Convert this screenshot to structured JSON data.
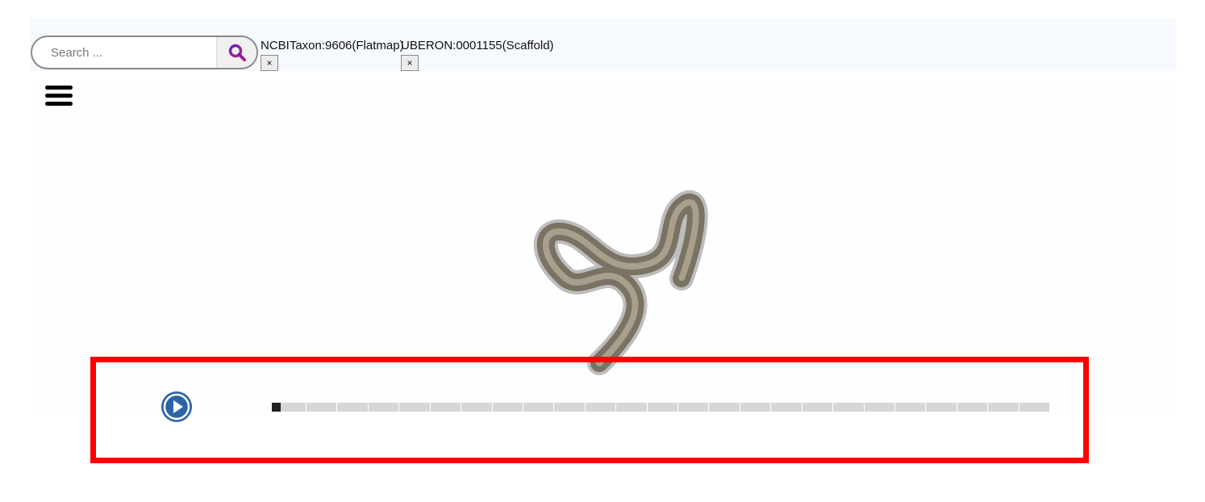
{
  "search": {
    "placeholder": "Search ..."
  },
  "tags": [
    {
      "label": "NCBITaxon:9606(Flatmap)",
      "close": "×"
    },
    {
      "label": "UBERON:0001155(Scaffold)",
      "close": "×"
    }
  ],
  "player": {
    "progress": 0,
    "accent": "#2c65a6"
  },
  "colors": {
    "highlight": "#ff0000",
    "search_icon": "#8a1ab8",
    "topbar_bg": "#f6f9fe"
  },
  "icons": {
    "search": "search-icon",
    "menu": "hamburger-menu-icon",
    "play": "play-icon"
  }
}
